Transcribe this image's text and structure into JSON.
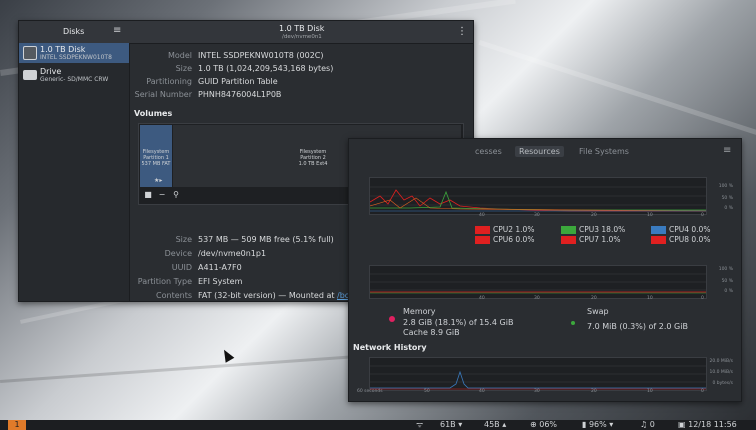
{
  "disks_window": {
    "sidebar_title": "Disks",
    "menu_icon": "hamburger-icon",
    "drives": [
      {
        "name": "1.0 TB Disk",
        "subtitle": "INTEL SSDPEKNW010T8"
      },
      {
        "name": "Drive",
        "subtitle": "Generic- SD/MMC CRW"
      }
    ],
    "title": "1.0 TB Disk",
    "subtitle": "/dev/nvme0n1",
    "info": [
      {
        "key": "Model",
        "value": "INTEL SSDPEKNW010T8 (002C)"
      },
      {
        "key": "Size",
        "value": "1.0 TB (1,024,209,543,168 bytes)"
      },
      {
        "key": "Partitioning",
        "value": "GUID Partition Table"
      },
      {
        "key": "Serial Number",
        "value": "PHNH8476004L1P0B"
      }
    ],
    "volumes_label": "Volumes",
    "partition1": {
      "l1": "Filesystem",
      "l2": "Partition 1",
      "l3": "537 MB FAT"
    },
    "partition2": {
      "l1": "Filesystem",
      "l2": "Partition 2",
      "l3": "1.0 TB Ext4"
    },
    "details": [
      {
        "key": "Size",
        "value": "537 MB — 509 MB free (5.1% full)"
      },
      {
        "key": "Device",
        "value": "/dev/nvme0n1p1"
      },
      {
        "key": "UUID",
        "value": "A411-A7F0"
      },
      {
        "key": "Partition Type",
        "value": "EFI System"
      },
      {
        "key": "Contents",
        "value": "FAT (32-bit version) — Mounted at",
        "link": "/boot/efi"
      }
    ]
  },
  "system_monitor": {
    "tabs": [
      "cesses",
      "Resources",
      "File Systems"
    ],
    "active_tab": "Resources",
    "cpu_graph": {
      "y_ticks": [
        "100 %",
        "50 %",
        "0 %"
      ],
      "x_ticks": [
        "40",
        "30",
        "20",
        "10",
        "0"
      ]
    },
    "cpus": [
      {
        "label": "CPU2 1.0%",
        "color": "#e02020"
      },
      {
        "label": "CPU3 18.0%",
        "color": "#3ca83c"
      },
      {
        "label": "CPU4 0.0%",
        "color": "#3a7bbf"
      },
      {
        "label": "CPU6 0.0%",
        "color": "#e02020"
      },
      {
        "label": "CPU7 1.0%",
        "color": "#e02020"
      },
      {
        "label": "CPU8 0.0%",
        "color": "#e02020"
      }
    ],
    "mem_graph": {
      "y_ticks": [
        "100 %",
        "50 %",
        "0 %"
      ],
      "x_ticks": [
        "40",
        "30",
        "20",
        "10",
        "0"
      ]
    },
    "memory": {
      "title": "Memory",
      "usage": "2.8 GiB (18.1%) of 15.4 GiB",
      "cache": "Cache 8.9 GiB"
    },
    "swap": {
      "title": "Swap",
      "usage": "7.0 MiB (0.3%) of 2.0 GiB"
    },
    "network_title": "Network History",
    "net_graph": {
      "y_ticks": [
        "20.0 MiB/s",
        "10.0 MiB/s",
        "0 bytes/s"
      ],
      "x_ticks": [
        "60 seconds",
        "50",
        "40",
        "30",
        "20",
        "10",
        "0"
      ]
    }
  },
  "taskbar": {
    "workspace": "1",
    "download": "61B",
    "upload": "45B",
    "cpu": "06%",
    "battery": "96%",
    "notifications": "0",
    "clock": "12/18 11:56"
  }
}
